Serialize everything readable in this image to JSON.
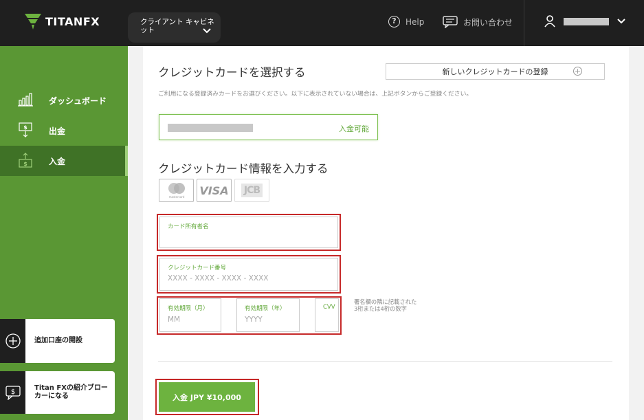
{
  "colors": {
    "topbar": "#1f1f1f",
    "sidebar": "#5a9734",
    "accent": "#6db33f",
    "highlight": "#c62828"
  },
  "header": {
    "logo_text": "TITANFX",
    "cabinet_line1": "クライアント キャビネ",
    "cabinet_line2": "ット",
    "help_label": "Help",
    "contact_label": "お問い合わせ",
    "user_icon": "person-icon"
  },
  "sidebar": {
    "items": [
      {
        "label": "ダッシュボード",
        "icon": "bar-chart-icon"
      },
      {
        "label": "出金",
        "icon": "withdraw-icon"
      },
      {
        "label": "入金",
        "icon": "deposit-icon"
      }
    ],
    "open_account_label": "追加口座の開設",
    "ib_label_line1": "Titan FXの紹介ブロー",
    "ib_label_line2": "カーになる"
  },
  "main": {
    "select_title": "クレジットカードを選択する",
    "new_card_button": "新しいクレジットカードの登録",
    "select_note": "ご利用になる登録済みカードをお選びください。以下に表示されていない場合は、上記ボタンからご登録ください。",
    "saved_card_status": "入金可能",
    "input_title": "クレジットカード情報を入力する",
    "card_logos": [
      "mastercard",
      "VISA",
      "JCB"
    ],
    "mastercard_text": "mastercard",
    "visa_text": "VISA",
    "jcb_text": "JCB",
    "holder_label": "カード所有者名",
    "holder_value": "",
    "number_label": "クレジットカード番号",
    "number_placeholder": "XXXX - XXXX - XXXX - XXXX",
    "month_label": "有効期限（月）",
    "month_placeholder": "MM",
    "year_label": "有効期限（年）",
    "year_placeholder": "YYYY",
    "cvv_label": "CVV",
    "cvv_note": "署名欄の隣に記載された3桁または4桁の数字",
    "submit_label": "入金 JPY ¥10,000"
  }
}
